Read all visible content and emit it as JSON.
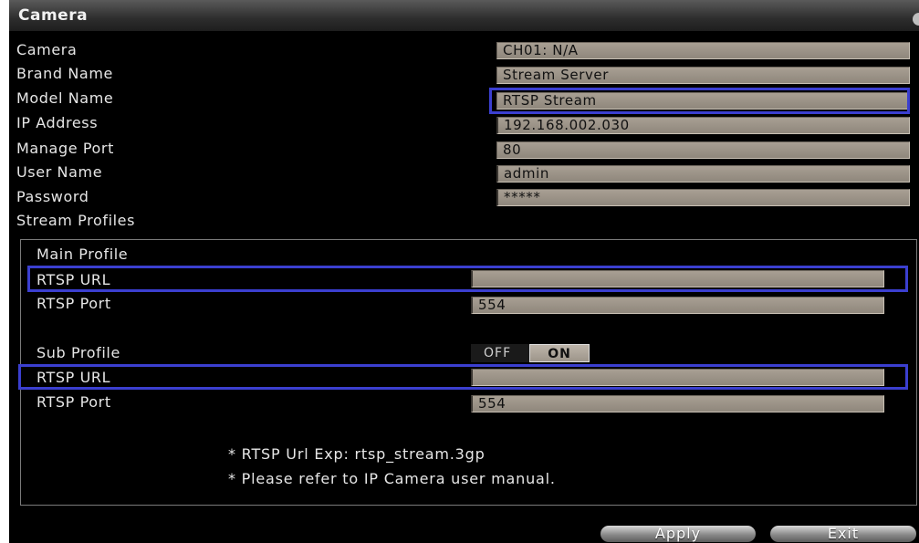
{
  "window": {
    "title": "Camera"
  },
  "form": {
    "camera_label": "Camera",
    "camera_value": "CH01: N/A",
    "brand_label": "Brand Name",
    "brand_value": "Stream Server",
    "model_label": "Model Name",
    "model_value": "RTSP Stream",
    "ip_label": "IP Address",
    "ip_value": "192.168.002.030",
    "port_label": "Manage Port",
    "port_value": "80",
    "user_label": "User Name",
    "user_value": "admin",
    "password_label": "Password",
    "password_value": "*****",
    "profiles_label": "Stream Profiles"
  },
  "main_profile": {
    "label": "Main Profile",
    "url_label": "RTSP URL",
    "url_value": "",
    "rtsp_port_label": "RTSP Port",
    "rtsp_port_value": "554"
  },
  "sub_profile": {
    "label": "Sub Profile",
    "toggle_off": "OFF",
    "toggle_on": "ON",
    "toggle_state": "ON",
    "url_label": "RTSP URL",
    "url_value": "",
    "rtsp_port_label": "RTSP Port",
    "rtsp_port_value": "554"
  },
  "notes": {
    "line1": "* RTSP Url Exp: rtsp_stream.3gp",
    "line2": "* Please refer to IP Camera user manual."
  },
  "buttons": {
    "apply": "Apply",
    "exit": "Exit"
  },
  "colors": {
    "highlight": "#3b3fd0",
    "field": "#9c9488",
    "background": "#000000"
  }
}
